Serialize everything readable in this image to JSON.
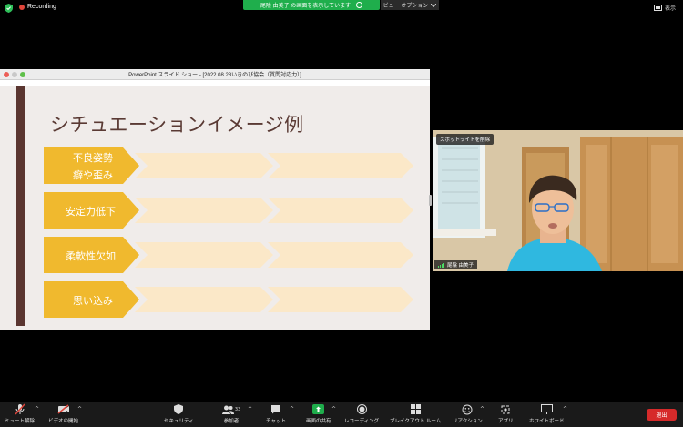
{
  "top": {
    "recording_label": "Recording",
    "share_banner": "尾陰 由美子 の画面を表示しています",
    "view_options": "ビュー オプション",
    "view_label": "表示"
  },
  "shared_window": {
    "title": "PowerPoint スライド ショー - [2022.08.28いきのび協会（質問対応力）]",
    "slide_title": "シチュエーションイメージ例",
    "items": [
      {
        "label": "不良姿勢",
        "label2": "癖や歪み"
      },
      {
        "label": "安定力低下"
      },
      {
        "label": "柔軟性欠如"
      },
      {
        "label": "思い込み"
      }
    ],
    "colors": {
      "accent": "#f0b92e",
      "accent_light": "#fbe8c8",
      "bar": "#5a3530",
      "title": "#5a3a34"
    }
  },
  "video": {
    "spotlight_button": "スポットライトを削除",
    "participant_name": "尾陰 由美子"
  },
  "toolbar": {
    "mute": "ミュート解除",
    "video": "ビデオの開始",
    "security": "セキュリティ",
    "participants": "参加者",
    "participants_count": "33",
    "chat": "チャット",
    "share": "画面の共有",
    "record": "レコーディング",
    "breakout": "ブレイクアウト ルーム",
    "reactions": "リアクション",
    "apps": "アプリ",
    "whiteboard": "ホワイトボード",
    "leave": "退出"
  },
  "icons": {
    "security": "shield-icon",
    "mic": "mic-muted-icon",
    "camera": "video-off-icon",
    "participants": "people-icon",
    "chat": "chat-bubble-icon",
    "share": "share-screen-icon",
    "record": "record-icon",
    "breakout": "breakout-grid-icon",
    "reactions": "emoji-icon",
    "apps": "apps-icon",
    "whiteboard": "whiteboard-icon"
  }
}
